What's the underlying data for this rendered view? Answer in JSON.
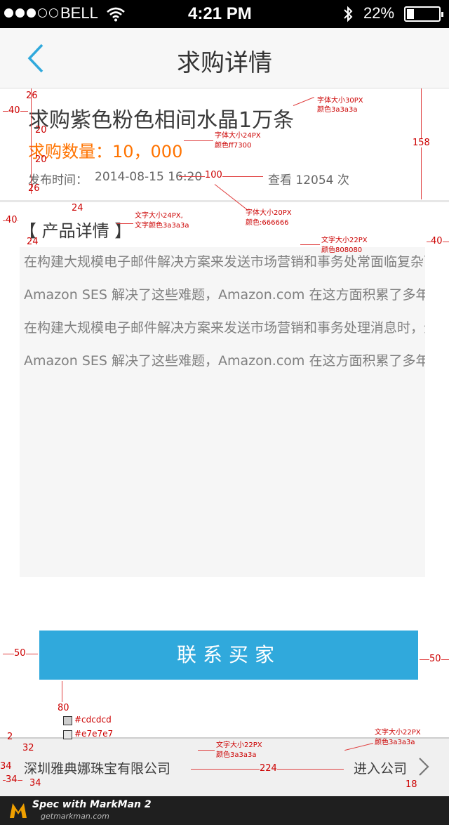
{
  "status_bar": {
    "carrier": "BELL",
    "time": "4:21 PM",
    "battery_percent": "22%",
    "signal_bars_filled": 3,
    "signal_bars_total": 5
  },
  "nav": {
    "title": "求购详情",
    "back_icon": "chevron-left-icon",
    "accent_color": "#30a9dc"
  },
  "request": {
    "title": "求购紫色粉色相间水晶1万条",
    "quantity_text": "求购数量：10，000",
    "publish_label": "发布时间：",
    "publish_date": "2014-08-15  16:20",
    "views_text": "查看 12054 次"
  },
  "details": {
    "section_title": "【 产品详情 】",
    "paragraphs": [
      "在构建大规模电子邮件解决方案来发送市场营销和事务处常面临复杂而代价高昂的挑战。为了优化成功发送电子邮件的百分比，会面临许多挑战，例如电子邮件服务器管理、网络配置以及 IP 地址声誉。许多第三方电子邮件解决方案要求签署合同和协商价格，而且还需要大量的前期费用。",
      "Amazon SES 解决了这些难题，Amazon.com 在这方面积累了多年的经验，并为自身的庞大客户群构建了完善的电子邮件基础设施，这些多年经验都会让您受益。您只需通过 SMTP 或简单的 API 调用，您就能访问高质量的可扩展电子邮件基础设施，以优惠的价格与客户进行高效的沟通。",
      "在构建大规模电子邮件解决方案来发送市场营销和事务处理消息时，企业常面临复杂而代价高昂的挑战。为了优化成功发送电子邮件的百分比，会面临许多挑战，例如电子邮件服务器管理、网络配置以及 IP 地址声誉。许多第三方电子邮件解决方案要求签署合同和协商价格，而且还需要大量的前期费用。",
      "Amazon SES 解决了这些难题，Amazon.com 在这方面积累了多年的经验，并为自身的庞大客户群构建了完善的电子邮件基础设施，这些都会让您受益。您只需通过 SMTP 或简单的 API 调用，您就能访问高质量的可扩展电子邮件基础设施。"
    ]
  },
  "contact_button_label": "联系买家",
  "company_bar": {
    "company_name": "深圳雅典娜珠宝有限公司",
    "enter_label": "进入公司",
    "chevron_icon": "chevron-right-icon"
  },
  "footer": {
    "brand_line": "Spec with MarkMan 2",
    "site": "getmarkman.com"
  },
  "annotations": {
    "title_font": "字体大小30PX",
    "title_color": "颜色3a3a3a",
    "qty_font": "字体大小24PX",
    "qty_color": "颜色ff7300",
    "meta_font": "字体大小20PX",
    "meta_color": "颜色:666666",
    "section_font": "文字大小24PX,",
    "section_color": "文字颜色3a3a3a",
    "content_font": "文字大小22PX",
    "content_color": "颜色808080",
    "company_font": "文字大小22PX",
    "company_color": "颜色3a3a3a",
    "enter_font": "文字大小22PX",
    "enter_color": "颜色3a3a3a",
    "swatch1": "#cdcdcd",
    "swatch2": "#e7e7e7",
    "m_26a": "26",
    "m_40a": "40",
    "m_20a": "20",
    "m_20b": "20",
    "m_26b": "26",
    "m_158": "158",
    "m_100": "100",
    "m_24a": "24",
    "m_40b": "40",
    "m_24b": "24",
    "m_40c": "40",
    "m_50a": "50",
    "m_50b": "50",
    "m_80": "80",
    "m_2": "2",
    "m_32": "32",
    "m_34a": "34",
    "m_34b": "34",
    "m_34c": "34",
    "m_224": "224",
    "m_18": "18"
  }
}
